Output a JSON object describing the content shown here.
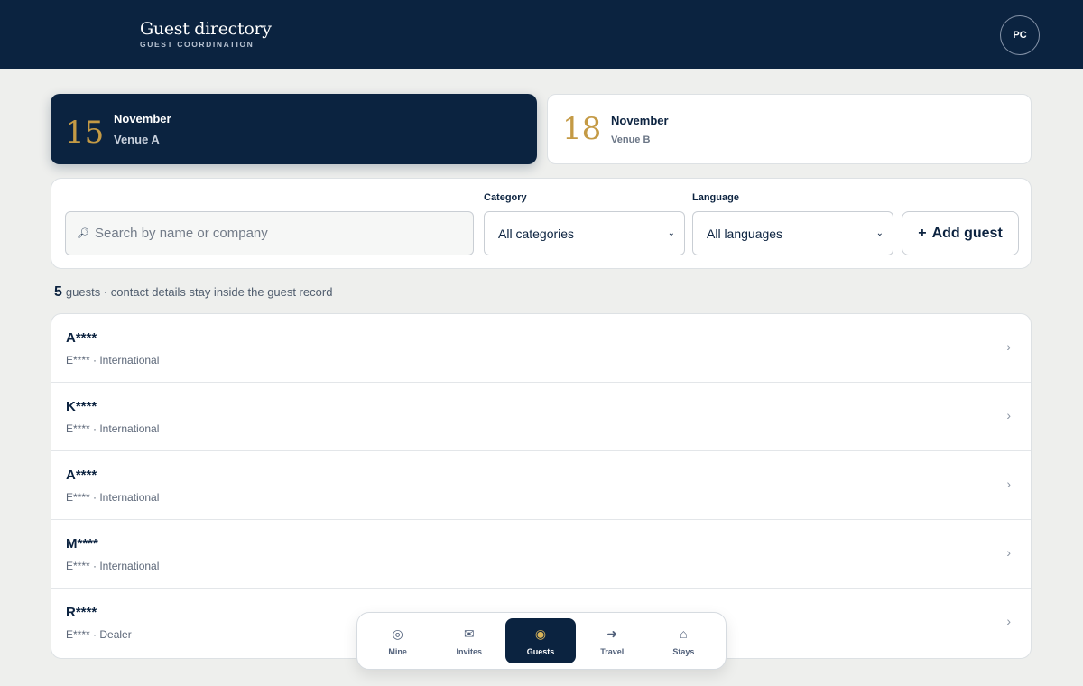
{
  "header": {
    "title": "Guest directory",
    "subtitle": "GUEST COORDINATION",
    "avatar_initials": "PC"
  },
  "dates": [
    {
      "day": "15",
      "month": "November",
      "venue": "Venue A",
      "active": true
    },
    {
      "day": "18",
      "month": "November",
      "venue": "Venue B",
      "active": false
    }
  ],
  "filters": {
    "search_placeholder": "Search by name or company",
    "search_icon": "search-icon",
    "category_label": "Category",
    "category_value": "All categories",
    "language_label": "Language",
    "language_value": "All languages",
    "add_plus": "+",
    "add_label": "Add guest"
  },
  "summary": {
    "count": "5",
    "text": "guests · contact details stay inside the guest record"
  },
  "guests": [
    {
      "name": "A****",
      "meta": "E**** · International"
    },
    {
      "name": "K****",
      "meta": "E**** · International"
    },
    {
      "name": "A****",
      "meta": "E**** · International"
    },
    {
      "name": "M****",
      "meta": "E**** · International"
    },
    {
      "name": "R****",
      "meta": "E**** · Dealer"
    }
  ],
  "nav": [
    {
      "label": "Mine",
      "icon": "◎",
      "icon_name": "target-icon",
      "active": false
    },
    {
      "label": "Invites",
      "icon": "✉",
      "icon_name": "envelope-icon",
      "active": false
    },
    {
      "label": "Guests",
      "icon": "◉",
      "icon_name": "guests-icon",
      "active": true
    },
    {
      "label": "Travel",
      "icon": "➜",
      "icon_name": "arrow-right-icon",
      "active": false
    },
    {
      "label": "Stays",
      "icon": "⌂",
      "icon_name": "home-icon",
      "active": false
    }
  ],
  "colors": {
    "navy": "#0b2340",
    "gold": "#c49a45",
    "background": "#eeefed"
  }
}
